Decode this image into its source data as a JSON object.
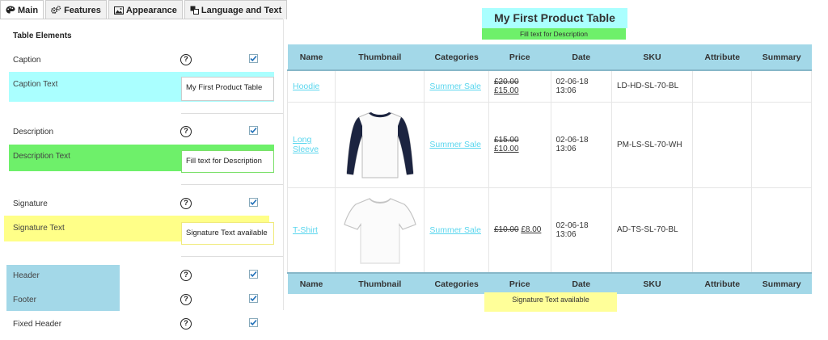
{
  "tabs": [
    {
      "label": "Main",
      "icon": "palette-icon"
    },
    {
      "label": "Features",
      "icon": "gears-icon"
    },
    {
      "label": "Appearance",
      "icon": "image-icon"
    },
    {
      "label": "Language and Text",
      "icon": "translate-icon"
    }
  ],
  "settings": {
    "section_title": "Table Elements",
    "caption_label": "Caption",
    "caption_text_label": "Caption Text",
    "caption_text_value": "My First Product Table",
    "description_label": "Description",
    "description_text_label": "Description Text",
    "description_text_value": "Fill text for Description",
    "signature_label": "Signature",
    "signature_text_label": "Signature Text",
    "signature_text_value": "Signature Text available",
    "header_label": "Header",
    "footer_label": "Footer",
    "fixed_header_label": "Fixed Header",
    "help_glyph": "?"
  },
  "preview": {
    "caption": "My First Product Table",
    "description": "Fill text for Description",
    "signature": "Signature Text available",
    "columns": [
      "Name",
      "Thumbnail",
      "Categories",
      "Price",
      "Date",
      "SKU",
      "Attribute",
      "Summary"
    ],
    "rows": [
      {
        "name": "Hoodie",
        "category": "Summer Sale",
        "old_price": "£20.00",
        "new_price": "£15.00",
        "date": "02-06-18 13:06",
        "sku": "LD-HD-SL-70-BL",
        "thumbnail": ""
      },
      {
        "name": "Long Sleeve",
        "category": "Summer Sale",
        "old_price": "£15.00",
        "new_price": "£10.00",
        "date": "02-06-18 13:06",
        "sku": "PM-LS-SL-70-WH",
        "thumbnail": "longsleeve-shirt-icon"
      },
      {
        "name": "T-Shirt",
        "category": "Summer Sale",
        "old_price": "£10.00",
        "new_price": "£8.00",
        "date": "02-06-18 13:06",
        "sku": "AD-TS-SL-70-BL",
        "thumbnail": "tshirt-icon"
      }
    ]
  },
  "colors": {
    "caption_bg": "#aaffff",
    "description_bg": "#6ef06a",
    "signature_bg": "#ffff99",
    "header_bg": "#a3d8e8",
    "link": "#5ad6ee"
  }
}
